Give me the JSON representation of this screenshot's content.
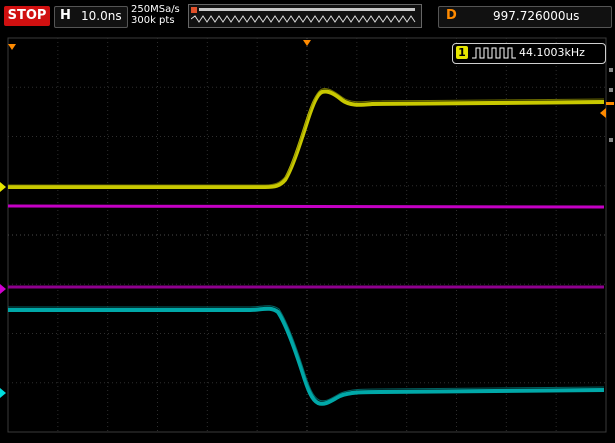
{
  "toolbar": {
    "run_state": "STOP",
    "timebase_label": "H",
    "timebase_value": "10.0ns",
    "sample_rate": "250MSa/s",
    "memory_depth": "300k pts",
    "delay_label": "D",
    "delay_value": "997.726000us"
  },
  "measure": {
    "channel": "1",
    "frequency": "44.1003kHz"
  },
  "colors": {
    "ch1": "#c8c800",
    "ch2": "#c400c4",
    "ch3": "#c400c4",
    "ch4": "#00b4b4",
    "trigger": "#ff8a00",
    "stop": "#d01010"
  }
}
